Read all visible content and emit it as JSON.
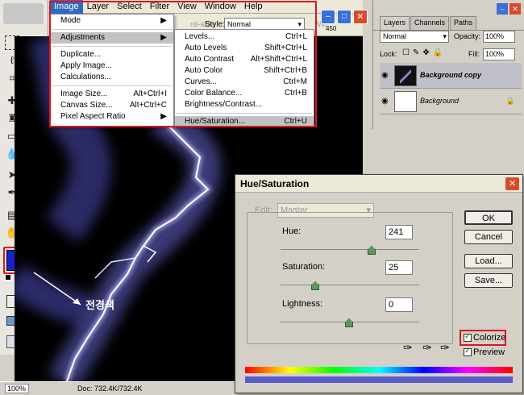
{
  "menubar": {
    "items": [
      "Image",
      "Layer",
      "Select",
      "Filter",
      "View",
      "Window",
      "Help"
    ]
  },
  "options_bar": {
    "aliased_label": "nti-alias",
    "style_label": "Style:",
    "style_value": "Normal",
    "wid_label": "Wid",
    "ruler": "450"
  },
  "image_menu": {
    "items": [
      {
        "label": "Mode",
        "shortcut": "",
        "arrow": "▶"
      },
      {
        "label": "Adjustments",
        "shortcut": "",
        "arrow": "▶"
      },
      {
        "label": "Duplicate...",
        "shortcut": ""
      },
      {
        "label": "Apply Image...",
        "shortcut": ""
      },
      {
        "label": "Calculations...",
        "shortcut": ""
      },
      {
        "label": "Image Size...",
        "shortcut": "Alt+Ctrl+I"
      },
      {
        "label": "Canvas Size...",
        "shortcut": "Alt+Ctrl+C"
      },
      {
        "label": "Pixel Aspect Ratio",
        "shortcut": "",
        "arrow": "▶"
      }
    ]
  },
  "adjustments_menu": {
    "items": [
      {
        "label": "Levels...",
        "shortcut": "Ctrl+L"
      },
      {
        "label": "Auto Levels",
        "shortcut": "Shift+Ctrl+L"
      },
      {
        "label": "Auto Contrast",
        "shortcut": "Alt+Shift+Ctrl+L"
      },
      {
        "label": "Auto Color",
        "shortcut": "Shift+Ctrl+B"
      },
      {
        "label": "Curves...",
        "shortcut": "Ctrl+M"
      },
      {
        "label": "Color Balance...",
        "shortcut": "Ctrl+B"
      },
      {
        "label": "Brightness/Contrast...",
        "shortcut": ""
      },
      {
        "label": "Hue/Saturation...",
        "shortcut": "Ctrl+U"
      }
    ]
  },
  "layers_panel": {
    "tabs": [
      "Layers",
      "Channels",
      "Paths"
    ],
    "blend_mode": "Normal",
    "opacity_label": "Opacity:",
    "opacity_value": "100%",
    "lock_label": "Lock:",
    "fill_label": "Fill:",
    "fill_value": "100%",
    "layers": [
      {
        "name": "Background copy"
      },
      {
        "name": "Background"
      }
    ]
  },
  "annotation": {
    "text": "전경색"
  },
  "status": {
    "zoom": "100%",
    "doc": "Doc: 732.4K/732.4K"
  },
  "hue_saturation": {
    "title": "Hue/Saturation",
    "edit_label": "Edit:",
    "edit_value": "Master",
    "hue_label": "Hue:",
    "hue_value": 241,
    "saturation_label": "Saturation:",
    "saturation_value": 25,
    "lightness_label": "Lightness:",
    "lightness_value": 0,
    "ok": "OK",
    "cancel": "Cancel",
    "load": "Load...",
    "save": "Save...",
    "colorize": "Colorize",
    "preview": "Preview"
  },
  "colors": {
    "foreground": "#1a1fd0",
    "highlight": "#e0141e",
    "panel": "#d4d0c8"
  }
}
